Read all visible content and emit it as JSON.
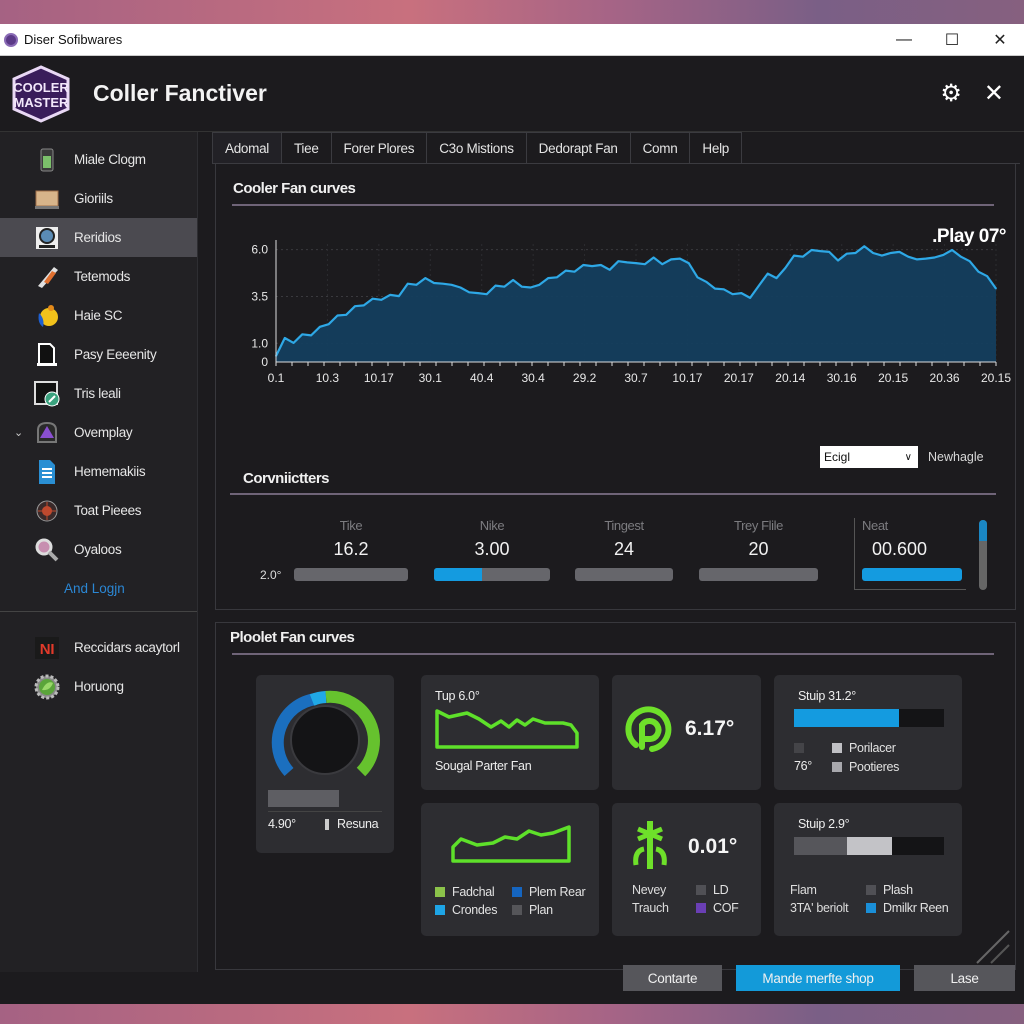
{
  "window": {
    "title": "Diser Sofibwares",
    "controls": {
      "minimize": "—",
      "maximize": "☐",
      "close": "✕"
    }
  },
  "header": {
    "logo_text_1": "COOLER",
    "logo_text_2": "MASTER",
    "app_title": "Coller Fanctiver",
    "settings_icon": "⚙",
    "close_icon": "✕"
  },
  "sidebar": {
    "items": [
      {
        "label": "Miale Clogm",
        "icon": "phone-icon"
      },
      {
        "label": "Gioriils",
        "icon": "easel-icon"
      },
      {
        "label": "Reridios",
        "icon": "webcam-icon",
        "active": true
      },
      {
        "label": "Tetemods",
        "icon": "pen-icon"
      },
      {
        "label": "Haie SC",
        "icon": "paint-icon"
      },
      {
        "label": "Pasy Eeeenity",
        "icon": "document-icon"
      },
      {
        "label": "Tris leali",
        "icon": "image-edit-icon"
      },
      {
        "label": "Ovemplay",
        "icon": "triangle-badge-icon",
        "expanded": true
      },
      {
        "label": "Hememakiis",
        "icon": "file-icon"
      },
      {
        "label": "Toat Pieees",
        "icon": "bug-icon"
      },
      {
        "label": "Oyaloos",
        "icon": "magnifier-icon"
      }
    ],
    "link": "And Logjn",
    "bottom_items": [
      {
        "label": "Reccidars acaytorl",
        "icon": "ni-icon"
      },
      {
        "label": "Horuong",
        "icon": "gear-leaf-icon"
      }
    ]
  },
  "tabs": [
    "Adomal",
    "Tiee",
    "Forer Plores",
    "C3o Mistions",
    "Dedorapt Fan",
    "Comn",
    "Help"
  ],
  "section1": {
    "title": "Cooler Fan curves",
    "badge": ".Play 07°"
  },
  "chart_data": {
    "type": "area",
    "title": "Cooler Fan curves",
    "annotation": ".Play 07°",
    "xlabel": "",
    "ylabel": "",
    "y_ticks": [
      "0",
      "1.0",
      "3.5",
      "6.0"
    ],
    "y_tick_values": [
      0,
      1.0,
      3.5,
      6.0
    ],
    "ylim": [
      0,
      6.3
    ],
    "x_tick_labels": [
      "0.1",
      "10.3",
      "10.17",
      "30.1",
      "40.4",
      "30.4",
      "29.2",
      "30.7",
      "10.17",
      "20.17",
      "20.14",
      "30.16",
      "20.15",
      "20.36",
      "20.15"
    ],
    "grid": true,
    "series": [
      {
        "name": "fan-curve",
        "color": "#2ea8e6",
        "fill": "#143e5e",
        "values": [
          0.4,
          1.2,
          1.1,
          1.4,
          1.5,
          1.8,
          2.1,
          2.4,
          2.6,
          2.9,
          3.1,
          3.3,
          3.4,
          3.5,
          3.6,
          4.1,
          4.2,
          4.4,
          4.3,
          4.1,
          4.2,
          3.9,
          3.8,
          3.6,
          3.7,
          4.0,
          4.1,
          4.3,
          4.1,
          3.9,
          4.2,
          4.4,
          4.6,
          4.8,
          4.9,
          5.1,
          5.2,
          5.1,
          5.0,
          5.3,
          5.4,
          5.2,
          5.3,
          5.5,
          5.3,
          5.4,
          5.6,
          5.2,
          4.6,
          4.2,
          4.0,
          3.8,
          3.7,
          3.6,
          3.5,
          4.0,
          4.8,
          4.4,
          5.1,
          5.6,
          5.7,
          5.9,
          6.0,
          5.8,
          5.5,
          5.7,
          5.9,
          6.1,
          5.9,
          5.6,
          5.9,
          5.8,
          5.7,
          5.4,
          5.6,
          5.5,
          5.8,
          5.9,
          5.7,
          5.3,
          4.9,
          4.5,
          4.0
        ]
      }
    ]
  },
  "section2": {
    "title": "Corvniictters",
    "select_value": "Ecigl",
    "select_label": "Newhagle",
    "prefix": "2.0°",
    "counters": [
      {
        "label": "Tike",
        "value": "16.2",
        "fill": 0
      },
      {
        "label": "Nike",
        "value": "3.00",
        "fill": 0.41
      },
      {
        "label": "Tingest",
        "value": "24",
        "fill": 0
      },
      {
        "label": "Trey Flile",
        "value": "20",
        "fill": 0
      },
      {
        "label": "Neat",
        "value": "00.600",
        "fill": 1.0
      }
    ]
  },
  "section3": {
    "title": "Ploolet Fan curves",
    "gauge": {
      "value": "4.90°",
      "legend": "Resuna",
      "progress": 0.65
    },
    "card_curve1": {
      "title": "Tup 6.0°",
      "caption": "Sougal Parter Fan"
    },
    "card_curve2": {
      "legend": [
        {
          "label": "Fadchal",
          "color": "#8bc34a"
        },
        {
          "label": "Plem Rear",
          "color": "#1565c0"
        },
        {
          "label": "Crondes",
          "color": "#1ea5e6"
        },
        {
          "label": "Plan",
          "color": "#555559"
        }
      ]
    },
    "card_p": {
      "value": "6.17°"
    },
    "card_tree": {
      "value": "0.01°",
      "left_labels": [
        "Nevey",
        "Trauch"
      ],
      "legend": [
        {
          "label": "LD",
          "color": "#505055"
        },
        {
          "label": "COF",
          "color": "#6a3fb5"
        }
      ]
    },
    "card_stup1": {
      "title": "Stuip 31.2°",
      "fill": 0.7,
      "side_value": "76°",
      "legend": [
        {
          "label": "Porilacer",
          "color": "#c0c0c4"
        },
        {
          "label": "Pootieres",
          "color": "#a8a8ad"
        }
      ]
    },
    "card_stup2": {
      "title": "Stuip 2.9°",
      "fill_dark": 0.35,
      "fill_light": 0.65,
      "left_labels": [
        "Flam",
        "3TA' beriolt"
      ],
      "legend": [
        {
          "label": "Plash",
          "color": "#505055"
        },
        {
          "label": "Dmilkr Reen",
          "color": "#1a8fd8"
        }
      ]
    }
  },
  "footer": {
    "buttons": [
      "Contarte",
      "Mande merfte shop",
      "Lase"
    ]
  },
  "colors": {
    "accent_blue": "#149be0",
    "accent_green": "#6ee02a",
    "brand_purple": "#5b2d8a"
  }
}
